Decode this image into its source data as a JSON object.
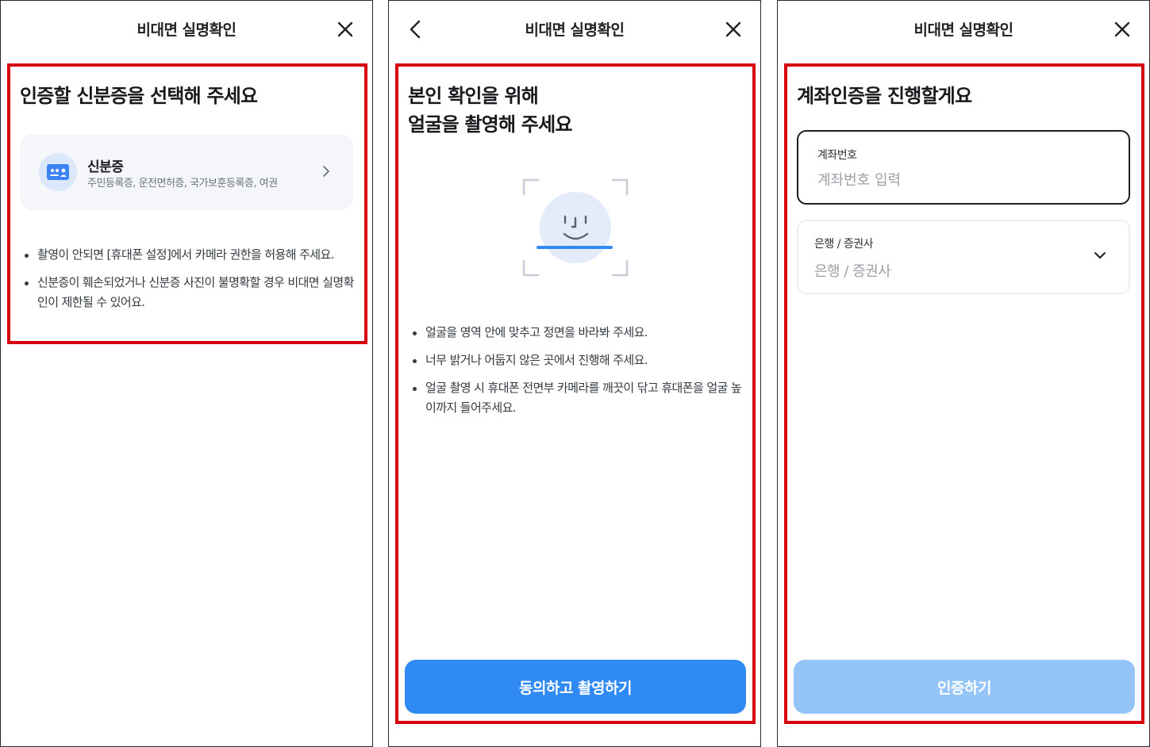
{
  "screens": [
    {
      "title": "비대면 실명확인",
      "heading": "인증할 신분증을 선택해 주세요",
      "id_option": {
        "title": "신분증",
        "subtitle": "주민등록증, 운전면허증, 국가보훈등록증, 여권"
      },
      "notes": [
        "촬영이 안되면 [휴대폰 설정]에서 카메라 권한을 허용해 주세요.",
        "신분증이 훼손되었거나 신분증 사진이 불명확할 경우 비대면 실명확인이 제한될 수 있어요."
      ]
    },
    {
      "title": "비대면 실명확인",
      "heading_line1": "본인 확인을 위해",
      "heading_line2": "얼굴을 촬영해 주세요",
      "notes": [
        "얼굴을 영역 안에 맞추고 정면을 바라봐 주세요.",
        "너무 밝거나 어둡지 않은 곳에서 진행해 주세요.",
        "얼굴 촬영 시 휴대폰 전면부 카메라를 깨끗이 닦고 휴대폰을 얼굴 높이까지 들어주세요."
      ],
      "button_label": "동의하고 촬영하기"
    },
    {
      "title": "비대면 실명확인",
      "heading": "계좌인증을 진행할게요",
      "account_field": {
        "label": "계좌번호",
        "placeholder": "계좌번호 입력"
      },
      "bank_field": {
        "label": "은행 / 증권사",
        "value": "은행 / 증권사"
      },
      "button_label": "인증하기"
    }
  ],
  "colors": {
    "highlight": "#d6000f",
    "primary": "#2f8af3",
    "primary_disabled": "#94c4f8",
    "card_bg": "#f4f6f9"
  }
}
